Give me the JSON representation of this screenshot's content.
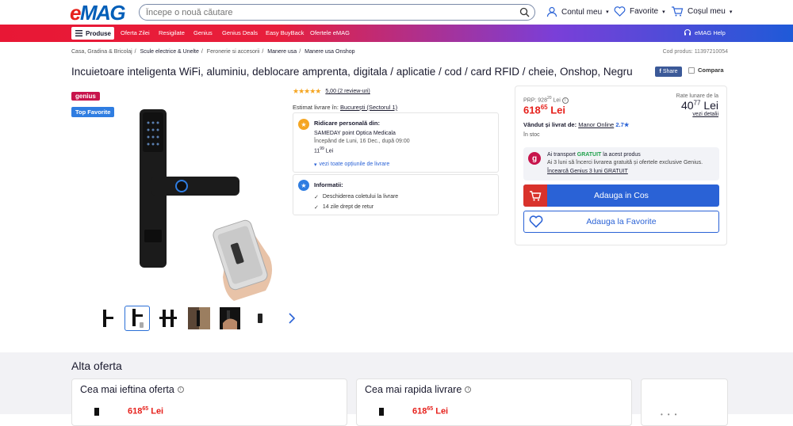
{
  "header": {
    "logo_e": "e",
    "logo_mag": "MAG",
    "search_placeholder": "Începe o nouă căutare",
    "account": "Contul meu",
    "favorites": "Favorite",
    "cart": "Coșul meu"
  },
  "nav": {
    "products": "Produse",
    "items": [
      "Oferta Zilei",
      "Resigilate",
      "Genius",
      "Genius Deals",
      "Easy BuyBack",
      "Ofertele eMAG"
    ],
    "help": "eMAG Help"
  },
  "breadcrumb": [
    "Casa, Gradina & Bricolaj",
    "Scule electrice & Unelte",
    "Feronerie si accesorii",
    "Manere usa",
    "Manere usa Onshop"
  ],
  "product_code": "Cod produs: 11397210054",
  "title": "Incuietoare inteligenta WiFi, aluminiu, deblocare amprenta, digitala / aplicatie / cod / card RFID / cheie, Onshop, Negru",
  "share": "Share",
  "compare": "Compara",
  "badges": {
    "genius": "genius",
    "top": "Top Favorite"
  },
  "rating": {
    "stars": "★★★★★",
    "text": "5,00 (2 review-uri)"
  },
  "delivery": {
    "estimate_label": "Estimat livrare în:",
    "estimate_place": "București (Sectorul 1)",
    "pickup_title": "Ridicare personală din:",
    "pickup_point": "SAMEDAY point Optica Medicala",
    "pickup_when": "Începând de Luni, 16 Dec., după 09:00",
    "pickup_price_int": "11",
    "pickup_price_dec": "99",
    "pickup_currency": "Lei",
    "options_link": "vezi toate opțiunile de livrare"
  },
  "info": {
    "title": "Informatii:",
    "items": [
      "Deschiderea coletului la livrare",
      "14 zile drept de retur"
    ]
  },
  "buy": {
    "prp": "PRP: 928",
    "prp_dec": "20",
    "prp_currency": "Lei",
    "price_int": "618",
    "price_dec": "65",
    "currency": "Lei",
    "rate_label_1": "Rate lunare de la",
    "rate_int": "40",
    "rate_dec": "77",
    "rate_currency": "Lei",
    "rate_link": "vezi detalii",
    "sold_by_label": "Vândut și livrat de:",
    "seller": "Manor Online",
    "seller_rating": "2.7",
    "stock": "în stoc",
    "genius_line1_a": "Ai transport ",
    "genius_line1_b": "GRATUIT",
    "genius_line1_c": " la acest produs",
    "genius_line2": "Ai 3 luni să încerci livrarea gratuită și ofertele exclusive Genius.",
    "genius_link": "Încearcă Genius 3 luni GRATUIT",
    "add_to_cart": "Adauga in Cos",
    "add_to_fav": "Adauga la Favorite"
  },
  "other_offers": {
    "title": "Alta oferta",
    "cards": [
      {
        "title": "Cea mai ieftina oferta",
        "price_int": "618",
        "price_dec": "65",
        "currency": "Lei"
      },
      {
        "title": "Cea mai rapida livrare",
        "price_int": "618",
        "price_dec": "65",
        "currency": "Lei"
      }
    ]
  },
  "colors": {
    "emag_red": "#e6211c",
    "emag_blue": "#005eb8",
    "cta_blue": "#2a62d6"
  }
}
